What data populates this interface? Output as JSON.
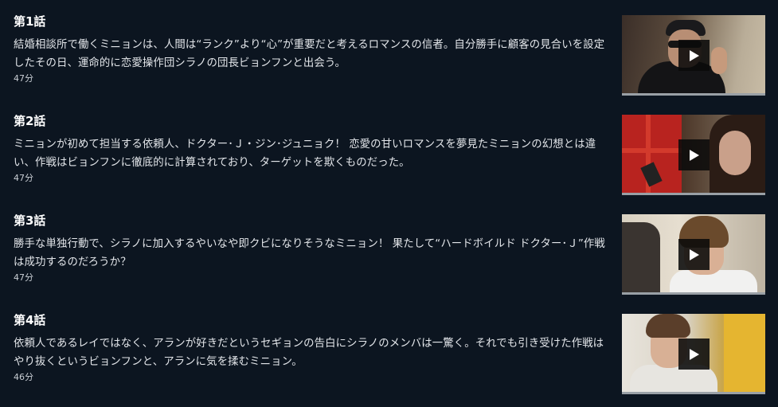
{
  "episodes": [
    {
      "title": "第1話",
      "description": "結婚相談所で働くミニョンは、人間は“ランク”より“心”が重要だと考えるロマンスの信者。自分勝手に顧客の見合いを設定したその日、運命的に恋愛操作団シラノの団長ビョンフンと出会う。",
      "duration": "47分",
      "thumbnail_icon": "play-icon"
    },
    {
      "title": "第2話",
      "description": "ミニョンが初めて担当する依頼人、ドクター･Ｊ・ジン･ジュニョク！ 恋愛の甘いロマンスを夢見たミニョンの幻想とは違い、作戦はビョンフンに徹底的に計算されており、ターゲットを欺くものだった。",
      "duration": "47分",
      "thumbnail_icon": "play-icon"
    },
    {
      "title": "第3話",
      "description": "勝手な単独行動で、シラノに加入するやいなや即クビになりそうなミニョン！ 果たして“ハードボイルド ドクター･Ｊ”作戦は成功するのだろうか？",
      "duration": "47分",
      "thumbnail_icon": "play-icon"
    },
    {
      "title": "第4話",
      "description": "依頼人であるレイではなく、アランが好きだというセギョンの告白にシラノのメンバは一驚く。それでも引き受けた作戦はやり抜くというビョンフンと、アランに気を揉むミニョン。",
      "duration": "46分",
      "thumbnail_icon": "play-icon"
    }
  ],
  "colors": {
    "background": "#0c1520",
    "title_text": "#ffffff",
    "description_text": "#e3e6ea",
    "play_button_bg": "#0a0a0a",
    "thumbnail_progress_bar": "#9aa0a6"
  }
}
